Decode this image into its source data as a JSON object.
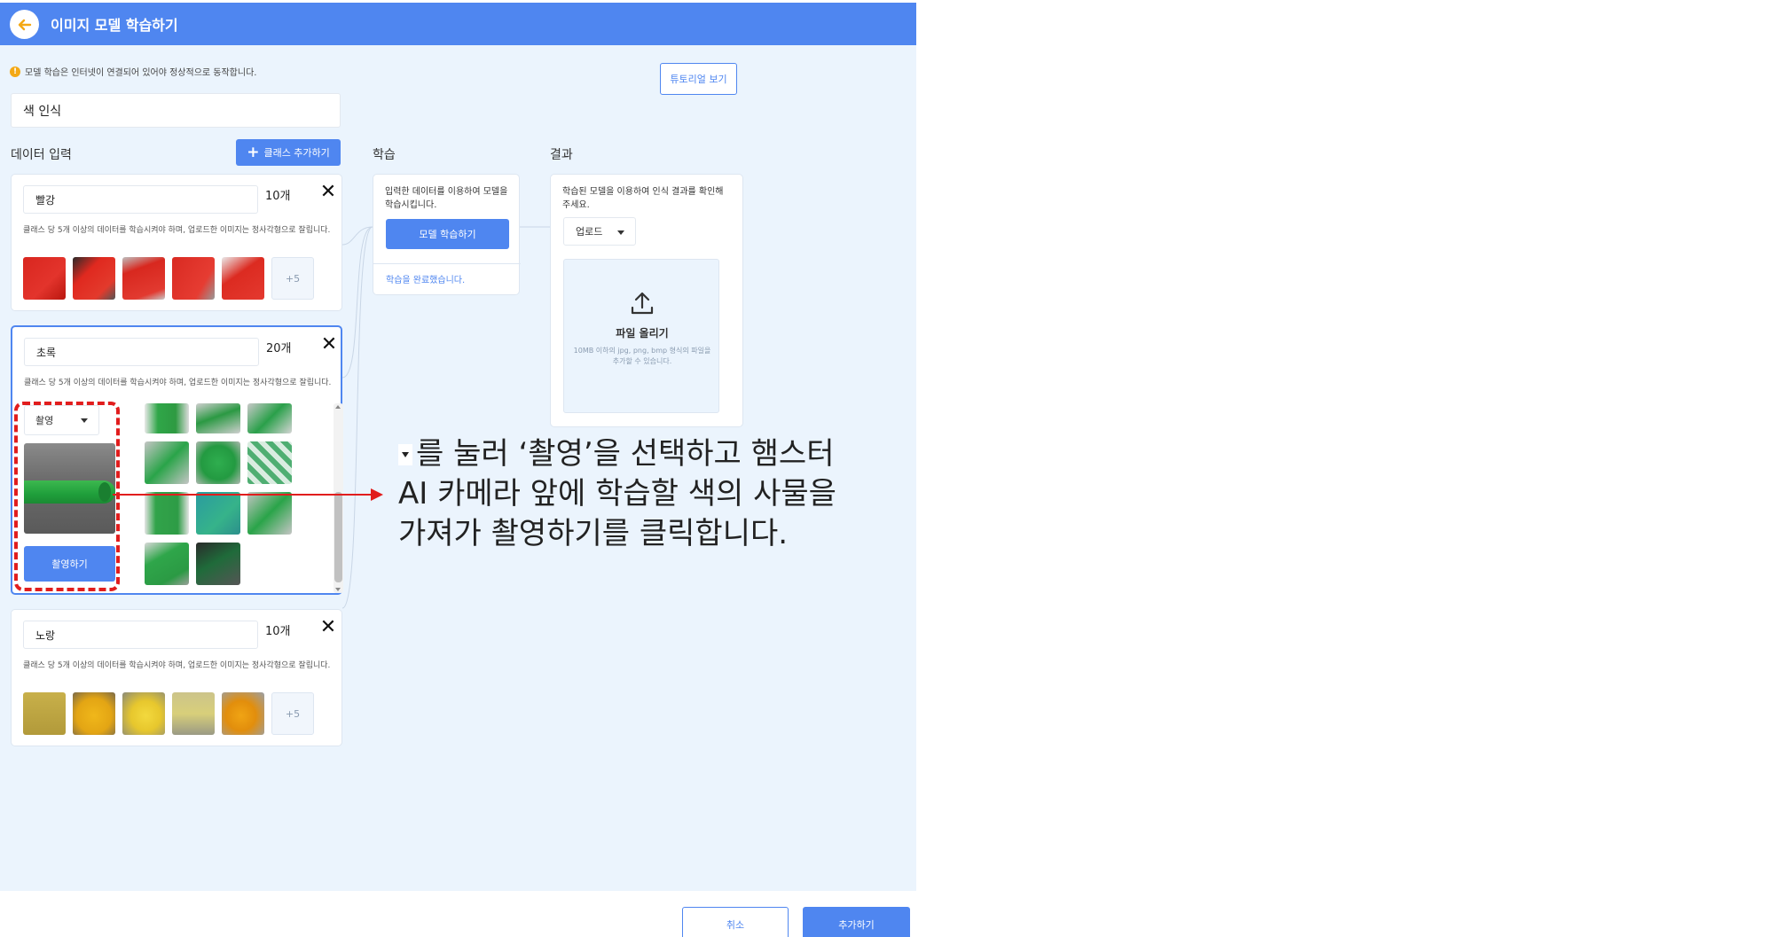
{
  "header": {
    "title": "이미지 모델 학습하기"
  },
  "notice": "모델 학습은 인터넷이 연결되어 있어야 정상적으로 동작합니다.",
  "tutorial_label": "튜토리얼 보기",
  "model_name": "색 인식",
  "sections": {
    "data_input": "데이터 입력",
    "training": "학습",
    "result": "결과"
  },
  "add_class_label": "클래스 추가하기",
  "hint_text": "클래스 당 5개 이상의 데이터를 학습시켜야 하며, 업로드한 이미지는 정사각형으로 잘립니다.",
  "classes": [
    {
      "name": "빨강",
      "count": "10개",
      "more": "+5"
    },
    {
      "name": "초록",
      "count": "20개"
    },
    {
      "name": "노랑",
      "count": "10개",
      "more": "+5"
    }
  ],
  "capture": {
    "mode": "촬영",
    "button": "촬영하기"
  },
  "train": {
    "description": "입력한 데이터를 이용하여 모델을 학습시킵니다.",
    "button": "모델 학습하기",
    "status": "학습을 완료했습니다."
  },
  "result": {
    "description": "학습된 모델을 이용하여 인식 결과를 확인해주세요.",
    "input_mode": "업로드",
    "upload_title": "파일 올리기",
    "upload_desc": "10MB 이하의 jpg, png, bmp 형식의 파일을 추가할 수 있습니다."
  },
  "footer": {
    "cancel": "취소",
    "add": "추가하기"
  },
  "annotation": {
    "text_line1": "를 눌러 ‘촬영’을 선택하고 햄스터",
    "text_line2": "AI 카메라 앞에 학습할 색의 사물을",
    "text_line3": "가져가 촬영하기를 클릭합니다."
  },
  "colors": {
    "accent": "#4f86f0",
    "background": "#ebf4fd",
    "annotation_red": "#e11d1d"
  }
}
